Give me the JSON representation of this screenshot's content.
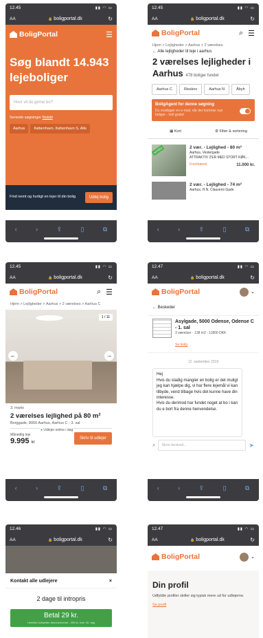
{
  "p1": {
    "time": "12.45",
    "url": "boligportal.dk",
    "aa": "AA",
    "brand": "BoligPortal",
    "headline": "Søg blandt 14.943 lejeboliger",
    "search_ph": "Hvor vil du gerne bo?",
    "recent_label": "Seneste søgninger",
    "reset": "Nulstil",
    "chips": [
      "Aarhus",
      "København, København S, Alle"
    ],
    "promo": "Find nemt og hurtigt en lejer til din bolig",
    "promo_btn": "Udlej bolig"
  },
  "p2": {
    "time": "12.45",
    "url": "boligportal.dk",
    "aa": "AA",
    "brand": "BoligPortal",
    "crumb": "Hjem > Lejligheder > Aarhus > 2 værelses",
    "back": "Alle lejligheder til leje i aarhus",
    "title": "2 værelses lejligheder i Aarhus",
    "count": "478 boliger fundet",
    "chips": [
      "Aarhus C",
      "Risskov",
      "Aarhus N",
      "Åbyh"
    ],
    "agent_title": "BoligAgent for denne søgning",
    "agent_text": "Du modtager en e-mail, når der kommer nye boliger - helt gratis!",
    "map": "Kort",
    "filter": "Filter & sortering",
    "listings": [
      {
        "title": "2 vær. - Lejlighed - 80 m²",
        "street": "Aarhus, Vestergade",
        "desc": "ATTRAKTIV 2'ER MED STORT KØK...",
        "tag": "Fremhævet",
        "price": "11.000 kr.",
        "badge": "NYHED"
      },
      {
        "title": "2 vær. - Lejlighed - 74 m²",
        "street": "Aarhus, H.N. Clausens Gade"
      }
    ]
  },
  "p3": {
    "time": "12.45",
    "url": "boligportal.dk",
    "aa": "AA",
    "brand": "BoligPortal",
    "crumb": "Hjem > Lejligheder > Aarhus > 2 værelses > Aarhus C",
    "counter": "1 / 11",
    "date": "3. marts",
    "title": "2 værelses lejlighed på 80 m²",
    "address": "Borggade, 8000 Aarhus, Aarhus C - 3. sal",
    "online": "Udlejer online i dag",
    "rent_label": "Månedlig leje",
    "rent": "9.995",
    "rent_unit": "kr",
    "cta": "Skriv til udlejer"
  },
  "p4": {
    "time": "12.47",
    "url": "boligportal.dk",
    "aa": "AA",
    "brand": "BoligPortal",
    "back": "Beskeder",
    "addr": "Asylgade, 5000 Odense, Odense C - 1. sal",
    "info": "3 værelser · 138 m2 · 11800 DKK",
    "link": "Se bolig",
    "date": "12. september 2019",
    "message": "Hej\nHvis du stadig mangler en bolig er det muligt jeg kan hjælpe dig, vi har flere lejemål vi kan tilbyde, vend tilbage hvis det kunne have din interesse.\nHvis du derimod har fundet noget at bo i kan du e bort fra denne henvendelse.",
    "input_ph": "Skriv besked..."
  },
  "p5": {
    "time": "12.46",
    "url": "boligportal.dk",
    "aa": "AA",
    "modal_title": "Kontakt alle udlejere",
    "offer": "2 dage til intropris",
    "pay": "Betal 29 kr.",
    "pay_sub": "Herefter fortsætter abonnementet - 299 kr. hver 30. dag"
  },
  "p6": {
    "time": "12.47",
    "url": "boligportal.dk",
    "aa": "AA",
    "brand": "BoligPortal",
    "title": "Din profil",
    "text": "Udfyldte profiler skiller sig typisk mere ud for udlejerne.",
    "link": "Se profil"
  },
  "colors": {
    "brand": "#e8743b",
    "dark": "#3c3c40",
    "navy": "#1f2d3d"
  }
}
